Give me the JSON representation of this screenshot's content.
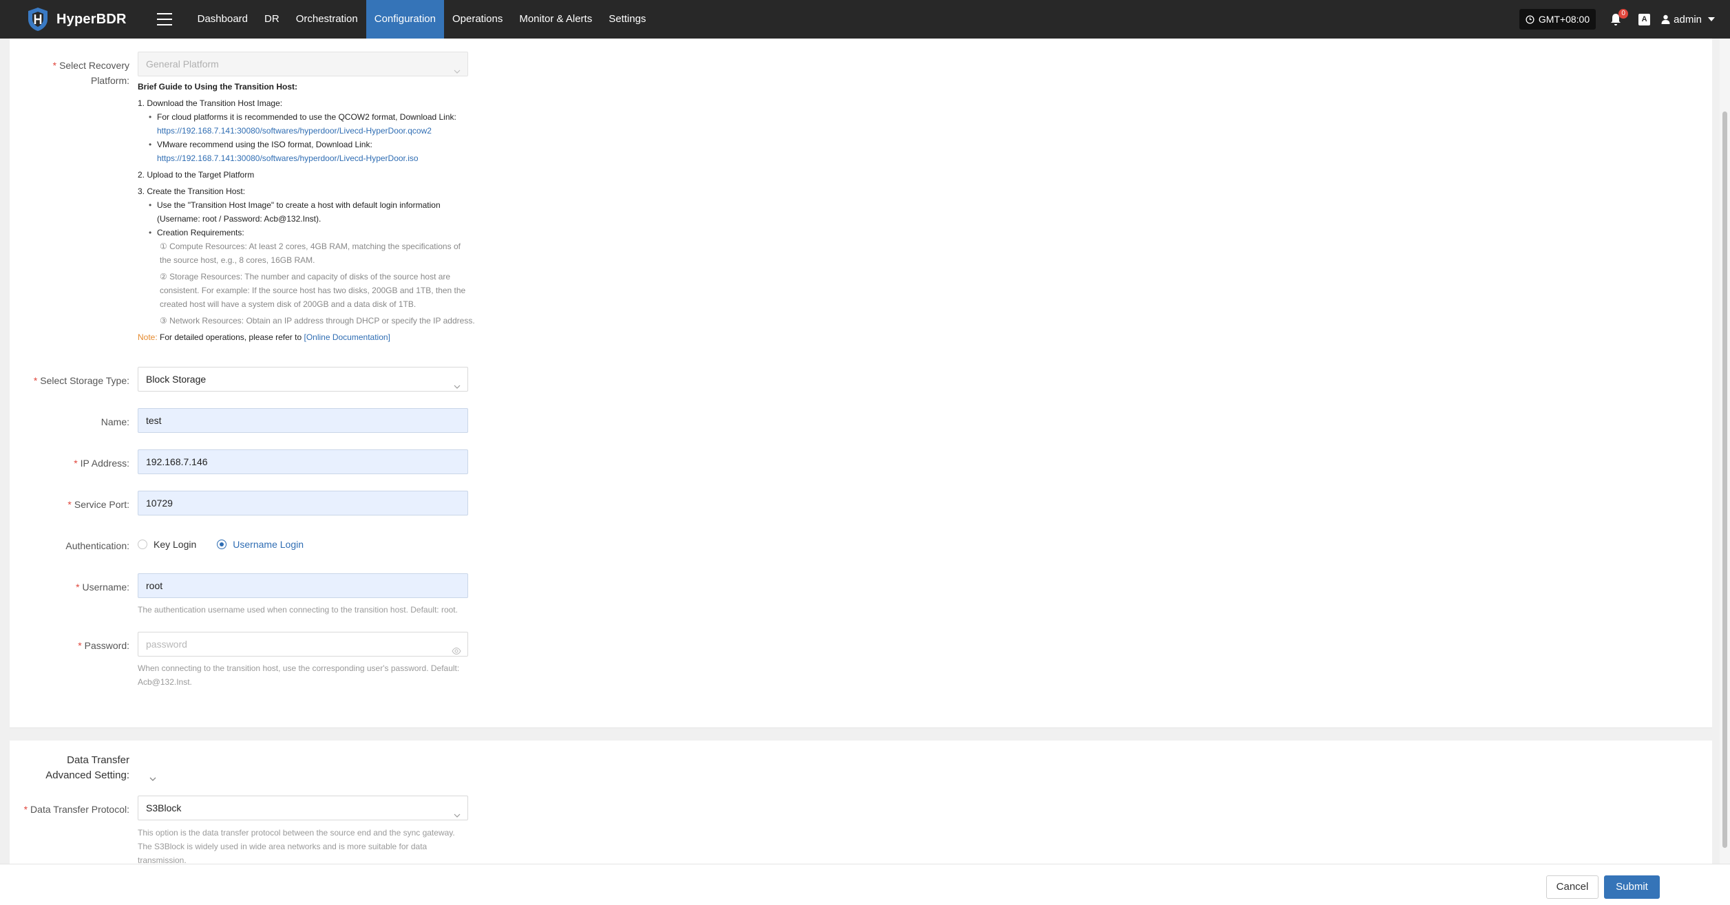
{
  "app": {
    "name": "HyperBDR"
  },
  "nav": {
    "items": [
      {
        "label": "Dashboard",
        "active": false
      },
      {
        "label": "DR",
        "active": false
      },
      {
        "label": "Orchestration",
        "active": false
      },
      {
        "label": "Configuration",
        "active": true
      },
      {
        "label": "Operations",
        "active": false
      },
      {
        "label": "Monitor & Alerts",
        "active": false
      },
      {
        "label": "Settings",
        "active": false
      }
    ]
  },
  "header": {
    "timezone": "GMT+08:00",
    "notification_count": "0",
    "lang_icon": "A",
    "user": "admin"
  },
  "form": {
    "recovery_platform": {
      "label_line1": "Select Recovery",
      "label_line2": "Platform:",
      "value": "General Platform"
    },
    "guide": {
      "title": "Brief Guide to Using the Transition Host:",
      "step1": "1. Download the Transition Host Image:",
      "step1_cloud": "For cloud platforms it is recommended to use the QCOW2 format, Download Link:",
      "step1_cloud_link": "https://192.168.7.141:30080/softwares/hyperdoor/Livecd-HyperDoor.qcow2",
      "step1_vmware": "VMware recommend using the ISO format, Download Link:",
      "step1_vmware_link": "https://192.168.7.141:30080/softwares/hyperdoor/Livecd-HyperDoor.iso",
      "step2": "2. Upload to the Target Platform",
      "step3": "3. Create the Transition Host:",
      "step3_use_line1": "Use the \"Transition Host Image\" to create a host with default login information",
      "step3_use_line2": "(Username: root / Password: Acb@132.Inst).",
      "step3_req": "Creation Requirements:",
      "req1_line1": "① Compute Resources: At least 2 cores, 4GB RAM, matching the specifications of",
      "req1_line2": "the source host, e.g., 8 cores, 16GB RAM.",
      "req2_line1": "② Storage Resources: The number and capacity of disks of the source host are",
      "req2_line2": "consistent. For example: If the source host has two disks, 200GB and 1TB, then the",
      "req2_line3": "created host will have a system disk of 200GB and a data disk of 1TB.",
      "req3": "③ Network Resources: Obtain an IP address through DHCP or specify the IP address.",
      "note_label": "Note:",
      "note_text": " For detailed operations, please refer to ",
      "note_link": "[Online Documentation]"
    },
    "storage_type": {
      "label": "Select Storage Type:",
      "value": "Block Storage"
    },
    "name": {
      "label": "Name:",
      "value": "test"
    },
    "ip": {
      "label": "IP Address:",
      "value": "192.168.7.146"
    },
    "port": {
      "label": "Service Port:",
      "value": "10729"
    },
    "auth": {
      "label": "Authentication:",
      "option_key": "Key Login",
      "option_user": "Username Login",
      "selected": "Username Login"
    },
    "username": {
      "label": "Username:",
      "value": "root",
      "help": "The authentication username used when connecting to the transition host. Default: root."
    },
    "password": {
      "label": "Password:",
      "placeholder": "password",
      "help_line1": "When connecting to the transition host, use the corresponding user's password. Default:",
      "help_line2": "Acb@132.Inst."
    }
  },
  "advanced": {
    "label_line1": "Data Transfer",
    "label_line2": "Advanced Setting:",
    "protocol": {
      "label": "Data Transfer Protocol:",
      "value": "S3Block",
      "help_line1": "This option is the data transfer protocol between the source end and the sync gateway.",
      "help_line2": "The S3Block is widely used in wide area networks and is more suitable for data",
      "help_line3": "transmission."
    }
  },
  "footer": {
    "cancel": "Cancel",
    "submit": "Submit"
  },
  "colors": {
    "accent": "#3574b8",
    "topbar": "#282828",
    "required": "#e0463c",
    "note": "#e58a2f"
  }
}
